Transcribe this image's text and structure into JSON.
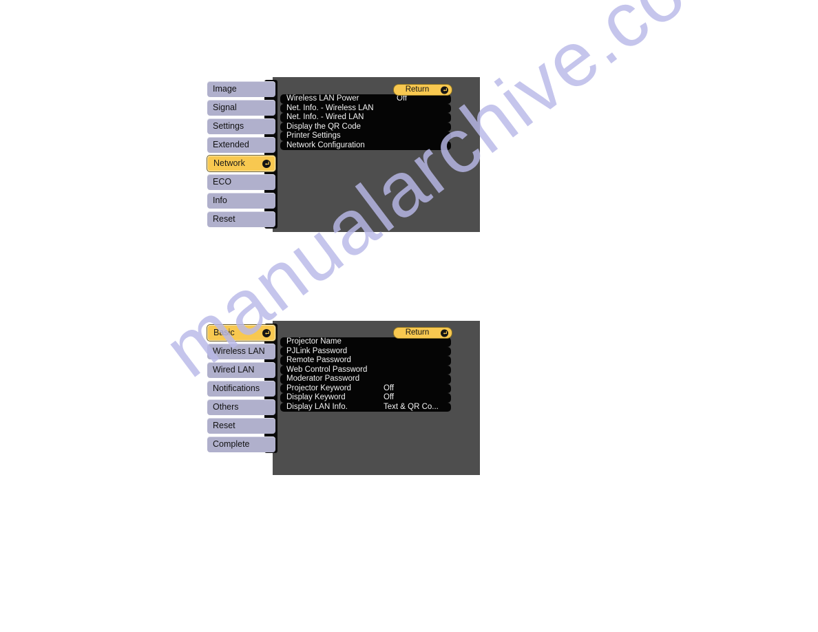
{
  "watermark": {
    "text": "manualarchive.com"
  },
  "colors": {
    "panel_bg": "#4e4e4e",
    "tab_bg": "#b0b0cc",
    "tab_selected_bg": "#f8c850",
    "list_bg": "#050505",
    "list_text": "#f2f2f2",
    "accent": "#f8c850"
  },
  "panels": [
    {
      "name": "network-menu",
      "return_label": "Return",
      "tabs": [
        {
          "label": "Image",
          "selected": false
        },
        {
          "label": "Signal",
          "selected": false
        },
        {
          "label": "Settings",
          "selected": false
        },
        {
          "label": "Extended",
          "selected": false
        },
        {
          "label": "Network",
          "selected": true
        },
        {
          "label": "ECO",
          "selected": false
        },
        {
          "label": "Info",
          "selected": false
        },
        {
          "label": "Reset",
          "selected": false
        }
      ],
      "items": [
        {
          "label": "Wireless LAN Power",
          "value": "Off"
        },
        {
          "label": "Net. Info. - Wireless LAN",
          "value": ""
        },
        {
          "label": "Net. Info. - Wired LAN",
          "value": ""
        },
        {
          "label": "Display the QR Code",
          "value": ""
        },
        {
          "label": "Printer Settings",
          "value": ""
        },
        {
          "label": "Network Configuration",
          "value": ""
        }
      ]
    },
    {
      "name": "network-configuration-basic-menu",
      "return_label": "Return",
      "tabs": [
        {
          "label": "Basic",
          "selected": true
        },
        {
          "label": "Wireless LAN",
          "selected": false
        },
        {
          "label": "Wired LAN",
          "selected": false
        },
        {
          "label": "Notifications",
          "selected": false
        },
        {
          "label": "Others",
          "selected": false
        },
        {
          "label": "Reset",
          "selected": false
        },
        {
          "label": "Complete",
          "selected": false
        }
      ],
      "items": [
        {
          "label": "Projector Name",
          "value": ""
        },
        {
          "label": "PJLink Password",
          "value": ""
        },
        {
          "label": "Remote Password",
          "value": ""
        },
        {
          "label": "Web Control Password",
          "value": ""
        },
        {
          "label": "Moderator Password",
          "value": ""
        },
        {
          "label": "Projector Keyword",
          "value": "Off"
        },
        {
          "label": "Display Keyword",
          "value": "Off"
        },
        {
          "label": "Display LAN Info.",
          "value": "Text & QR Co..."
        }
      ]
    }
  ]
}
